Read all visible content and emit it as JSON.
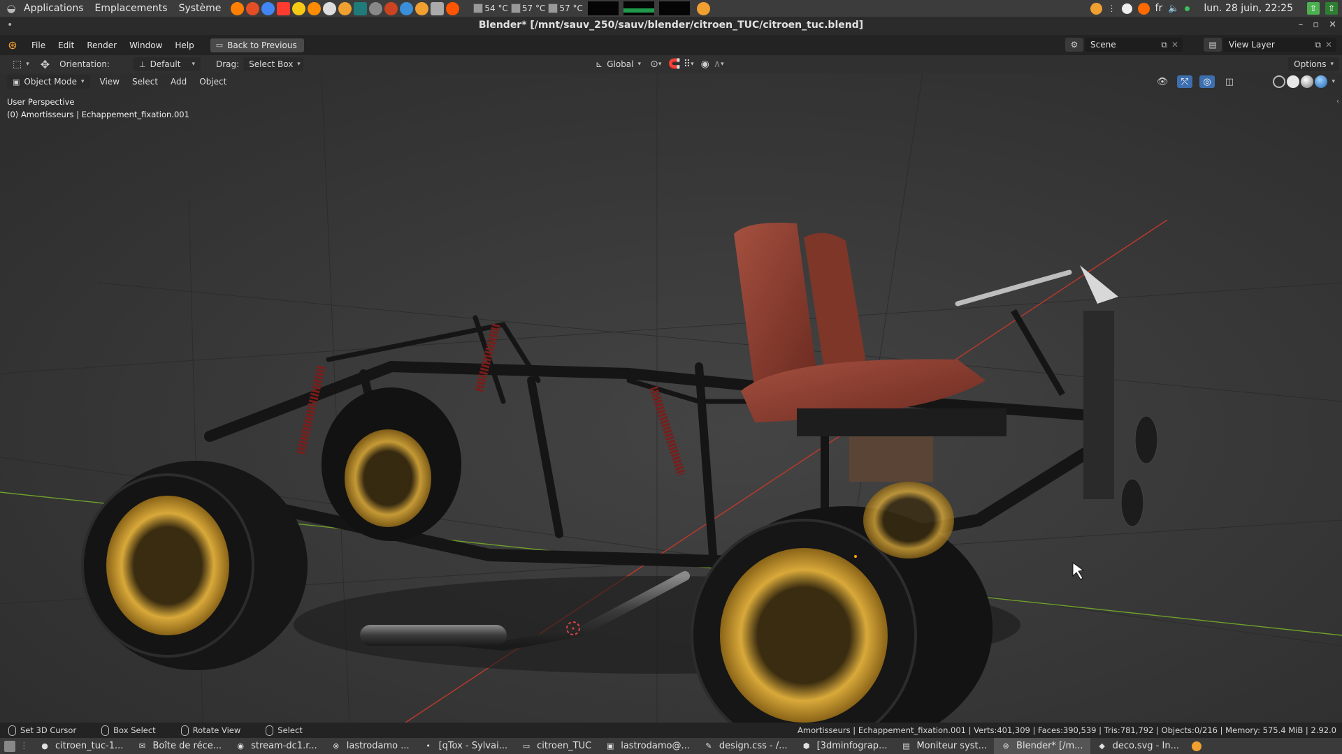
{
  "desktop_panel": {
    "menus": [
      "Applications",
      "Emplacements",
      "Système"
    ],
    "temperatures": [
      "54 °C",
      "57 °C",
      "57 °C"
    ],
    "language": "fr",
    "clock": "lun. 28 juin, 22:25",
    "launcher_colors": [
      "#ff7f00",
      "#e44d26",
      "#4285f4",
      "#ff3b30",
      "#f6c915",
      "#ff8c00",
      "#dddddd",
      "#f0a030",
      "#1f7a7a",
      "#888888",
      "#cc4422",
      "#3a8fd8",
      "#f0a030",
      "#aaaaaa",
      "#ff5500"
    ]
  },
  "window": {
    "title": "Blender* [/mnt/sauv_250/sauv/blender/citroen_TUC/citroen_tuc.blend]"
  },
  "topbar": {
    "menu": [
      "File",
      "Edit",
      "Render",
      "Window",
      "Help"
    ],
    "back_button": "Back to Previous",
    "scene": "Scene",
    "view_layer": "View Layer"
  },
  "tool_header": {
    "orientation_label": "Orientation:",
    "orientation_value": "Default",
    "drag_label": "Drag:",
    "drag_value": "Select Box",
    "transform_orientation": "Global",
    "options": "Options"
  },
  "viewport_header": {
    "mode": "Object Mode",
    "menu": [
      "View",
      "Select",
      "Add",
      "Object"
    ]
  },
  "viewport": {
    "perspective": "User Perspective",
    "collection_object": "(0) Amortisseurs | Echappement_fixation.001"
  },
  "statusbar": {
    "hints": [
      "Set 3D Cursor",
      "Box Select",
      "Rotate View",
      "Select"
    ],
    "stats": "Amortisseurs | Echappement_fixation.001 | Verts:401,309 | Faces:390,539 | Tris:781,792 | Objects:0/216 | Memory: 575.4 MiB | 2.92.0"
  },
  "taskbar": {
    "tasks": [
      "citroen_tuc-1...",
      "Boîte de récе...",
      "stream-dc1.r...",
      "lastrodamo ...",
      "[qTox - Sylvai...",
      "citroen_TUC",
      "lastrodamo@...",
      "design.css - /...",
      "[3dminfograp...",
      "Moniteur syst...",
      "Blender* [/m...",
      "deco.svg - In..."
    ],
    "active_index": 10
  },
  "colors": {
    "seat_leather": "#8a3a2c",
    "rim_gold": "#c8962a",
    "tire": "#161616",
    "x_axis": "#c0392b",
    "y_axis": "#6fa02a",
    "accent_blue": "#3d6fae"
  }
}
